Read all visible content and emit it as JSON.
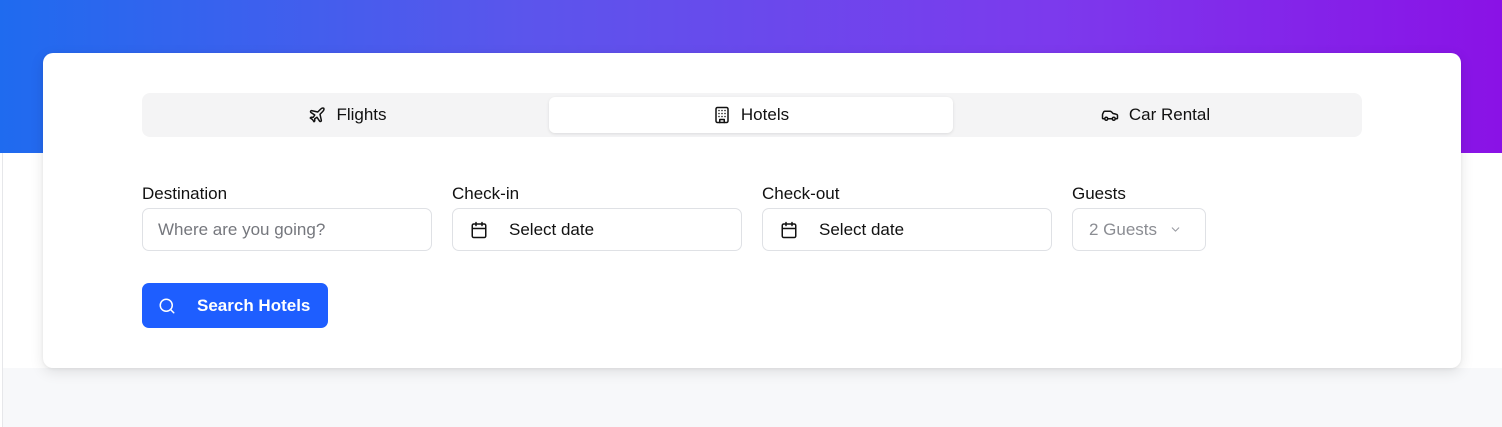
{
  "tabs": {
    "flights_label": "Flights",
    "hotels_label": "Hotels",
    "car_rental_label": "Car Rental",
    "active": "Hotels"
  },
  "form": {
    "destination": {
      "label": "Destination",
      "placeholder": "Where are you going?",
      "value": ""
    },
    "check_in": {
      "label": "Check-in",
      "value": "Select date"
    },
    "check_out": {
      "label": "Check-out",
      "value": "Select date"
    },
    "guests": {
      "label": "Guests",
      "value": "2 Guests"
    }
  },
  "search_button": {
    "label": "Search Hotels"
  },
  "icons": {
    "flights": "plane-icon",
    "hotels": "building-icon",
    "car_rental": "car-icon",
    "date": "calendar-icon",
    "guests_dropdown": "chevron-down-icon",
    "search": "search-icon"
  },
  "colors": {
    "gradient_start": "#1f6bef",
    "gradient_end": "#8a12e6",
    "primary_button": "#1e5eff",
    "tab_track": "#f4f4f5"
  }
}
